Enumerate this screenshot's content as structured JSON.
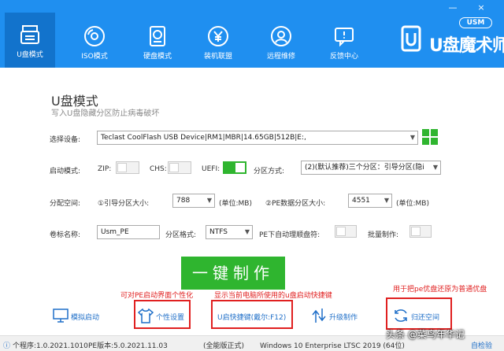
{
  "window": {
    "minimize": "—",
    "close": "×"
  },
  "nav": {
    "items": [
      {
        "label": "U盘模式",
        "icon": "usb-drive-icon"
      },
      {
        "label": "ISO模式",
        "icon": "disc-icon"
      },
      {
        "label": "硬盘模式",
        "icon": "hard-disk-icon"
      },
      {
        "label": "装机联盟",
        "icon": "yen-coin-icon"
      },
      {
        "label": "远程维修",
        "icon": "remote-support-icon"
      },
      {
        "label": "反馈中心",
        "icon": "feedback-icon"
      }
    ],
    "active_index": 0
  },
  "brand": {
    "usm": "USM",
    "name": "U盘魔术师"
  },
  "page": {
    "title": "U盘模式",
    "subtitle": "写入U盘隐藏分区防止病毒破坏"
  },
  "form": {
    "device_label": "选择设备:",
    "device_value": "Teclast CoolFlash USB Device|RM1|MBR|14.65GB|512B|E:,",
    "boot_mode_label": "启动模式:",
    "zip_label": "ZIP:",
    "chs_label": "CHS:",
    "uefi_label": "UEFI:",
    "zip_on": false,
    "chs_on": false,
    "uefi_on": true,
    "partition_mode_label": "分区方式:",
    "partition_mode_value": "(2)(默认推荐)三个分区：引导分区(隐i",
    "alloc_label": "分配空间:",
    "boot_part_label": "①引导分区大小:",
    "boot_part_value": "788",
    "boot_part_unit": "(单位:MB)",
    "pe_part_label": "②PE数据分区大小:",
    "pe_part_value": "4551",
    "pe_part_unit": "(单位:MB)",
    "volume_label": "卷标名称:",
    "volume_value": "Usm_PE",
    "format_label": "分区格式:",
    "format_value": "NTFS",
    "pe_auto_label": "PE下自动理顺盘符:",
    "batch_label": "批量制作:"
  },
  "start_button": "一键制作",
  "annotations": {
    "personal": "可对PE启动界面个性化",
    "hotkey": "显示当前电脑所使用的u盘启动快捷键",
    "restore": "用于把pe优盘还原为普通优盘"
  },
  "tools": [
    {
      "label": "模拟启动",
      "icon": "monitor-icon"
    },
    {
      "label": "个性设置",
      "icon": "tshirt-icon"
    },
    {
      "label": "U启快捷键(戴尔:F12)",
      "icon": "keyboard-icon"
    },
    {
      "label": "升级制作",
      "icon": "upgrade-arrows-icon"
    },
    {
      "label": "归还空间",
      "icon": "restore-icon"
    }
  ],
  "status": {
    "program_version": "个程序:1.0.2021.1010",
    "pe_version": "PE版本:5.0.2021.11.03",
    "edition": "(全能版正式)",
    "os": "Windows 10 Enterprise LTSC 2019 (64位)",
    "self_check": "自检验"
  },
  "watermark": "头条 @菜鸟年华记",
  "colors": {
    "nav_bg": "#1f8ff0",
    "nav_active": "#1273cc",
    "green": "#2fb52f",
    "annotation_red": "#e02020",
    "tool_blue": "#1f6fc8"
  }
}
